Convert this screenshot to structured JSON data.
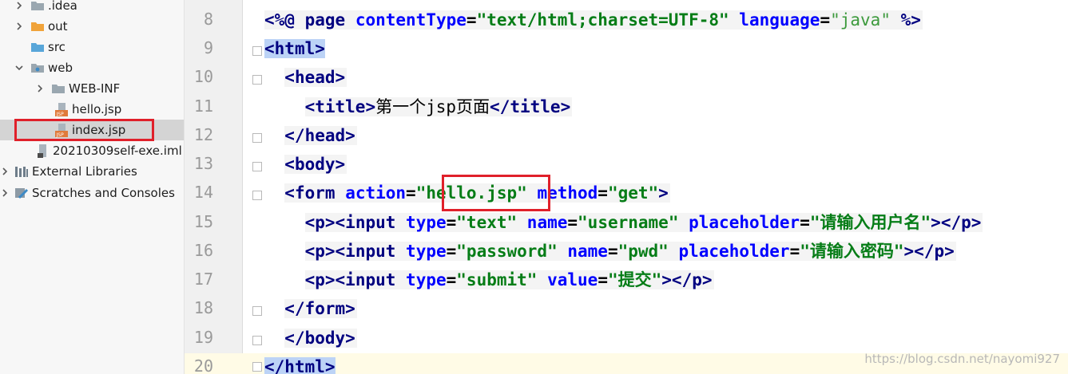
{
  "project_tree": {
    "items": [
      {
        "label": ".idea",
        "icon": "folder-icon",
        "expander": "collapsed"
      },
      {
        "label": "out",
        "icon": "folder-orange-icon",
        "expander": "collapsed"
      },
      {
        "label": "src",
        "icon": "folder-blue-icon",
        "expander": "none"
      },
      {
        "label": "web",
        "icon": "folder-web-icon",
        "expander": "expanded"
      },
      {
        "label": "WEB-INF",
        "icon": "folder-icon",
        "expander": "collapsed"
      },
      {
        "label": "hello.jsp",
        "icon": "jsp-file-icon",
        "expander": "none"
      },
      {
        "label": "index.jsp",
        "icon": "jsp-file-icon",
        "expander": "none",
        "selected": true
      },
      {
        "label": "20210309self-exe.iml",
        "icon": "iml-file-icon",
        "expander": "none"
      },
      {
        "label": "External Libraries",
        "icon": "libraries-icon",
        "expander": "collapsed"
      },
      {
        "label": "Scratches and Consoles",
        "icon": "scratches-icon",
        "expander": "collapsed"
      }
    ]
  },
  "editor": {
    "line_numbers": [
      "8",
      "9",
      "10",
      "11",
      "12",
      "13",
      "14",
      "15",
      "16",
      "17",
      "18",
      "19",
      "20"
    ],
    "code": {
      "l8": {
        "open": "<%@",
        "kw": "page",
        "a1": "contentType",
        "eq1": "=",
        "v1": "\"text/html;charset=UTF-8\"",
        "a2": "language",
        "eq2": "=",
        "v2": "\"java\"",
        "close": "%>"
      },
      "l9": {
        "lt": "<",
        "tag": "html",
        "gt": ">"
      },
      "l10": {
        "lt": "<",
        "tag": "head",
        "gt": ">"
      },
      "l11": {
        "lt": "<",
        "tag": "title",
        "gt": ">",
        "text": "第一个jsp页面",
        "lt2": "</",
        "tag2": "title",
        "gt2": ">"
      },
      "l12": {
        "lt": "</",
        "tag": "head",
        "gt": ">"
      },
      "l13": {
        "lt": "<",
        "tag": "body",
        "gt": ">"
      },
      "l14": {
        "lt": "<",
        "tag": "form",
        "a1": "action",
        "eq1": "=",
        "v1": "\"hello.jsp\"",
        "a2": "method",
        "eq2": "=",
        "v2": "\"get\"",
        "gt": ">"
      },
      "l15": {
        "p_open": "<p>",
        "lt": "<",
        "tag": "input",
        "a1": "type",
        "v1": "\"text\"",
        "a2": "name",
        "v2": "\"username\"",
        "a3": "placeholder",
        "v3": "\"请输入用户名\"",
        "gt": ">",
        "p_close": "</p>"
      },
      "l16": {
        "p_open": "<p>",
        "lt": "<",
        "tag": "input",
        "a1": "type",
        "v1": "\"password\"",
        "a2": "name",
        "v2": "\"pwd\"",
        "a3": "placeholder",
        "v3": "\"请输入密码\"",
        "gt": ">",
        "p_close": "</p>"
      },
      "l17": {
        "p_open": "<p>",
        "lt": "<",
        "tag": "input",
        "a1": "type",
        "v1": "\"submit\"",
        "a2": "value",
        "v2": "\"提交\"",
        "gt": ">",
        "p_close": "</p>"
      },
      "l18": {
        "lt": "</",
        "tag": "form",
        "gt": ">"
      },
      "l19": {
        "lt": "</",
        "tag": "body",
        "gt": ">"
      },
      "l20": {
        "lt": "</",
        "tag": "html",
        "gt": ">"
      }
    },
    "watermark": "https://blog.csdn.net/nayomi927"
  },
  "colors": {
    "highlight_box": "#e0202a",
    "tag": "#000080",
    "attribute": "#0000ff",
    "value": "#067d17",
    "selected_row": "#d4d4d4",
    "matched_tag_bg": "#bcd3f6"
  }
}
